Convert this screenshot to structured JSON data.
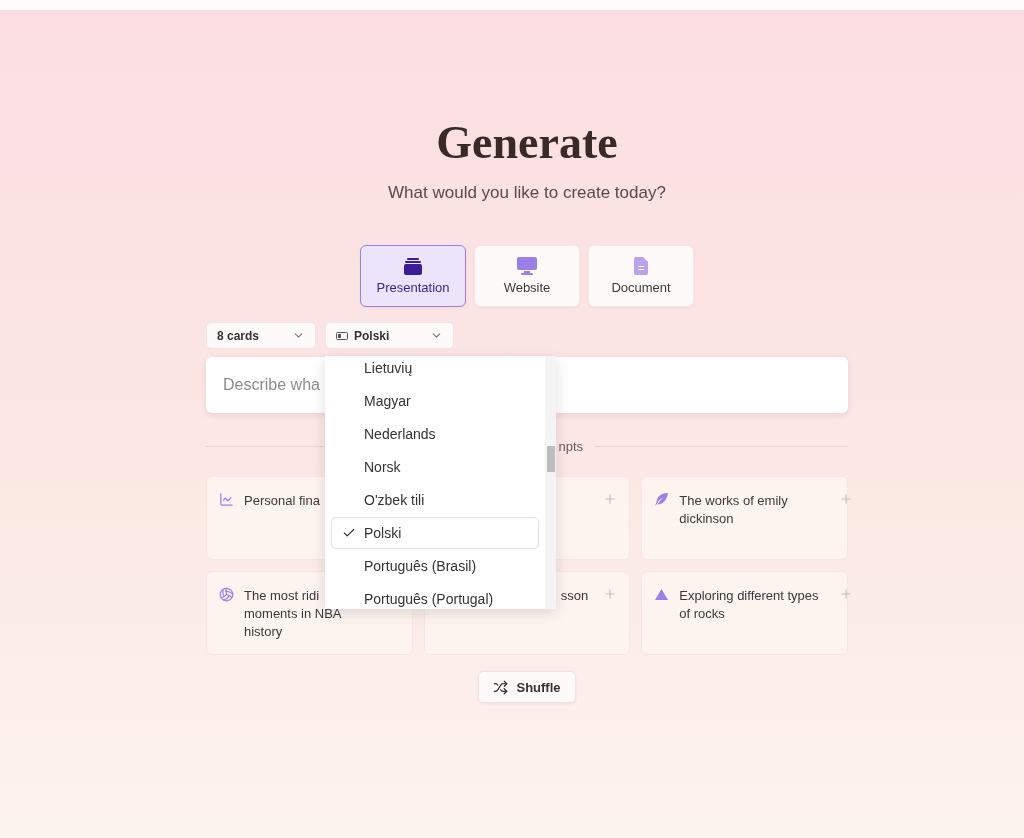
{
  "header": {
    "title": "Generate",
    "subtitle": "What would you like to create today?"
  },
  "modes": [
    {
      "label": "Presentation",
      "kind": "presentation",
      "selected": true
    },
    {
      "label": "Website",
      "kind": "website",
      "selected": false
    },
    {
      "label": "Document",
      "kind": "document",
      "selected": false
    }
  ],
  "card_count": {
    "value": "8 cards"
  },
  "language": {
    "value": "Polski"
  },
  "prompt": {
    "placeholder": "Describe wha"
  },
  "divider": {
    "label": "npts"
  },
  "prompts": [
    {
      "text": "Personal fina",
      "kind": "chart",
      "covered": false
    },
    {
      "kind": "none",
      "covered": true
    },
    {
      "text": "The works of emily dickinson",
      "kind": "feather",
      "covered": false
    },
    {
      "text": "The most ridi\nmoments in NBA\nhistory",
      "kind": "ball",
      "covered": false
    },
    {
      "text": "sson",
      "kind": "none",
      "covered": true
    },
    {
      "text": "Exploring different types of rocks",
      "kind": "mountain",
      "covered": false
    }
  ],
  "language_menu": {
    "items": [
      {
        "label": "Lietuvių",
        "selected": false
      },
      {
        "label": "Magyar",
        "selected": false
      },
      {
        "label": "Nederlands",
        "selected": false
      },
      {
        "label": "Norsk",
        "selected": false
      },
      {
        "label": "O'zbek tili",
        "selected": false
      },
      {
        "label": "Polski",
        "selected": true
      },
      {
        "label": "Português (Brasil)",
        "selected": false
      },
      {
        "label": "Português (Portugal)",
        "selected": false
      }
    ]
  },
  "shuffle": {
    "label": "Shuffle"
  }
}
